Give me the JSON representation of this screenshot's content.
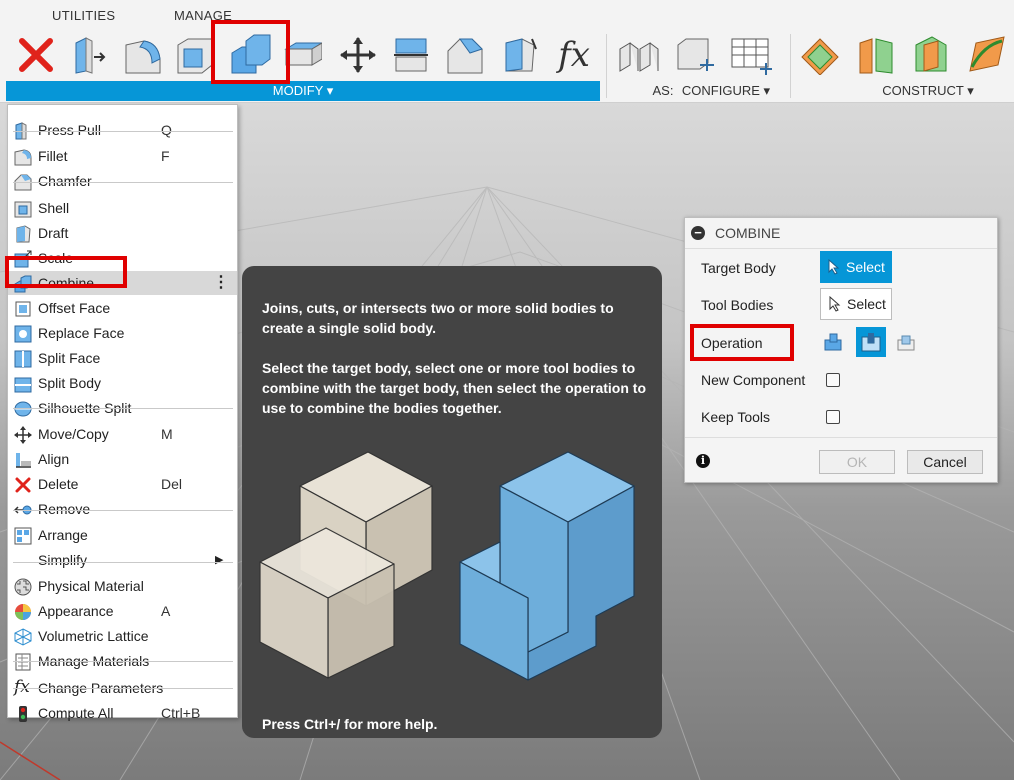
{
  "toolbar": {
    "tabs": [
      "UTILITIES",
      "MANAGE"
    ],
    "groups": {
      "modify": "MODIFY ▾",
      "assemble": "AS:",
      "configure": "CONFIGURE ▾",
      "construct": "CONSTRUCT ▾"
    },
    "fx_label": "fx"
  },
  "menu": {
    "items": [
      {
        "label": "Press Pull",
        "shortcut": "Q",
        "icon": "press-pull-icon"
      },
      {
        "label": "Fillet",
        "shortcut": "F",
        "icon": "fillet-icon"
      },
      {
        "label": "Chamfer",
        "shortcut": "",
        "icon": "chamfer-icon"
      },
      {
        "label": "Shell",
        "shortcut": "",
        "icon": "shell-icon"
      },
      {
        "label": "Draft",
        "shortcut": "",
        "icon": "draft-icon"
      },
      {
        "label": "Scale",
        "shortcut": "",
        "icon": "scale-icon"
      },
      {
        "label": "Combine",
        "shortcut": "",
        "icon": "combine-icon"
      },
      {
        "label": "Offset Face",
        "shortcut": "",
        "icon": "offset-face-icon"
      },
      {
        "label": "Replace Face",
        "shortcut": "",
        "icon": "replace-face-icon"
      },
      {
        "label": "Split Face",
        "shortcut": "",
        "icon": "split-face-icon"
      },
      {
        "label": "Split Body",
        "shortcut": "",
        "icon": "split-body-icon"
      },
      {
        "label": "Silhouette Split",
        "shortcut": "",
        "icon": "silhouette-split-icon"
      },
      {
        "label": "Move/Copy",
        "shortcut": "M",
        "icon": "move-copy-icon"
      },
      {
        "label": "Align",
        "shortcut": "",
        "icon": "align-icon"
      },
      {
        "label": "Delete",
        "shortcut": "Del",
        "icon": "delete-icon"
      },
      {
        "label": "Remove",
        "shortcut": "",
        "icon": "remove-icon"
      },
      {
        "label": "Arrange",
        "shortcut": "",
        "icon": "arrange-icon"
      },
      {
        "label": "Simplify",
        "shortcut": "",
        "icon": "simplify-icon"
      },
      {
        "label": "Physical Material",
        "shortcut": "",
        "icon": "physical-material-icon"
      },
      {
        "label": "Appearance",
        "shortcut": "A",
        "icon": "appearance-icon"
      },
      {
        "label": "Volumetric Lattice",
        "shortcut": "",
        "icon": "volumetric-lattice-icon"
      },
      {
        "label": "Manage Materials",
        "shortcut": "",
        "icon": "manage-materials-icon"
      },
      {
        "label": "Change Parameters",
        "shortcut": "",
        "icon": "fx-icon"
      },
      {
        "label": "Compute All",
        "shortcut": "Ctrl+B",
        "icon": "compute-all-icon"
      }
    ],
    "more_icon": "⋮",
    "submenu_arrow": "▶",
    "fx_glyph": "fx"
  },
  "tooltip": {
    "para1": "Joins, cuts, or intersects two or more solid bodies to create a single solid body.",
    "para2": "Select the target body, select one or more tool bodies to combine with the target body, then select the operation to use to combine the bodies together.",
    "footer": "Press Ctrl+/ for more help."
  },
  "dialog": {
    "title": "COMBINE",
    "target_body_label": "Target Body",
    "tool_bodies_label": "Tool Bodies",
    "operation_label": "Operation",
    "new_component_label": "New Component",
    "keep_tools_label": "Keep Tools",
    "select_label": "Select",
    "ok_label": "OK",
    "cancel_label": "Cancel",
    "info_glyph": "i",
    "collapse_glyph": "−",
    "accent": "#0696d7"
  }
}
